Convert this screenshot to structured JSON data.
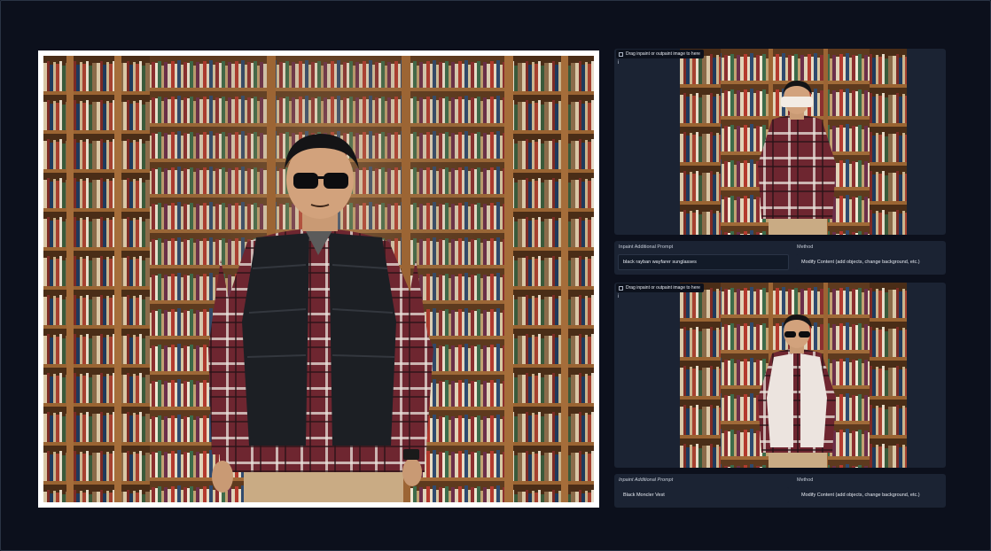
{
  "panels": [
    {
      "upload_label": "Drag inpaint or outpaint image to here",
      "info_icon": "i",
      "prompt_label": "Inpaint Additional Prompt",
      "prompt_value": "black rayban wayfarer sunglasses",
      "method_label": "Method",
      "method_value": "Modify Content (add objects, change background, etc.)"
    },
    {
      "upload_label": "Drag inpaint or outpaint image to here",
      "info_icon": "i",
      "prompt_label": "Inpaint Additional Prompt",
      "prompt_value": "Black Moncler Vest",
      "method_label": "Method",
      "method_value": "Modify Content (add objects, change background, etc.)"
    }
  ],
  "colors": {
    "page_bg": "#0c101c",
    "panel_bg": "#1b2333",
    "field_bg": "#121a28",
    "shelf_wood": "#8a5a2e",
    "shirt_red": "#7a2a34",
    "vest_black": "#1c1f24"
  },
  "icons": {
    "upload": "image-icon",
    "info": "info-icon"
  }
}
